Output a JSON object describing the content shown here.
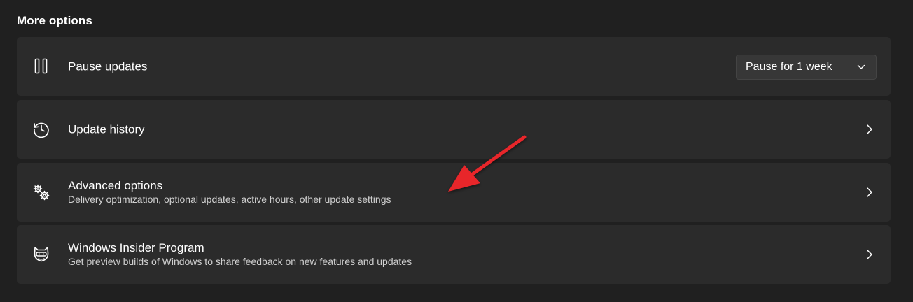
{
  "section_title": "More options",
  "pause_updates": {
    "title": "Pause updates",
    "icon": "pause-icon",
    "dropdown_value": "Pause for 1 week"
  },
  "update_history": {
    "title": "Update history",
    "icon": "history-icon"
  },
  "advanced_options": {
    "title": "Advanced options",
    "subtitle": "Delivery optimization, optional updates, active hours, other update settings",
    "icon": "gears-icon"
  },
  "insider_program": {
    "title": "Windows Insider Program",
    "subtitle": "Get preview builds of Windows to share feedback on new features and updates",
    "icon": "ninja-cat-icon"
  },
  "colors": {
    "background": "#202020",
    "card": "#2b2b2b",
    "annotation_arrow": "#e8262c"
  }
}
